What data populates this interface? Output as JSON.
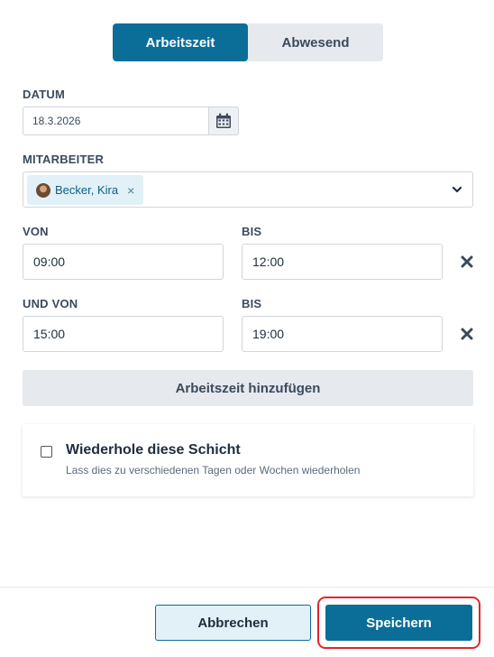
{
  "tabs": {
    "work_time": "Arbeitszeit",
    "absent": "Abwesend"
  },
  "date": {
    "label": "DATUM",
    "value": "18.3.2026",
    "icon": "calendar-icon"
  },
  "employee": {
    "label": "MITARBEITER",
    "selected": "Becker, Kira",
    "remove_glyph": "×",
    "icon": "chevron-down-icon"
  },
  "shifts": [
    {
      "from_label": "VON",
      "from_value": "09:00",
      "to_label": "BIS",
      "to_value": "12:00"
    },
    {
      "from_label": "UND VON",
      "from_value": "15:00",
      "to_label": "BIS",
      "to_value": "19:00"
    }
  ],
  "add_work_time": "Arbeitszeit hinzufügen",
  "repeat": {
    "title": "Wiederhole diese Schicht",
    "subtitle": "Lass dies zu verschiedenen Tagen oder Wochen wiederholen",
    "checked": false
  },
  "footer": {
    "cancel": "Abbrechen",
    "save": "Speichern"
  },
  "colors": {
    "primary": "#0b6e99",
    "highlight": "#e0262e",
    "chip_bg": "#e1f1f7"
  }
}
